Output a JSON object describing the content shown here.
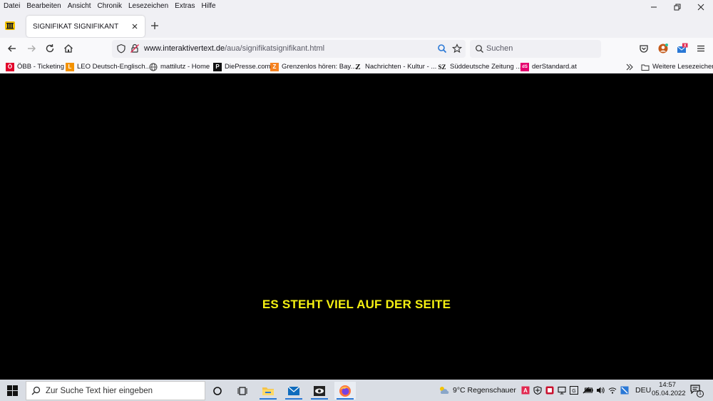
{
  "menu": [
    "Datei",
    "Bearbeiten",
    "Ansicht",
    "Chronik",
    "Lesezeichen",
    "Extras",
    "Hilfe"
  ],
  "tab": {
    "title": "SIGNIFIKAT SIGNIFIKANT"
  },
  "url": {
    "host": "www.interaktivertext.de",
    "path": "/aua/signifikatsignifikant.html"
  },
  "search": {
    "placeholder": "Suchen"
  },
  "bookmarks": [
    {
      "label": "ÖBB - Ticketing",
      "icon": "oebb-icon",
      "color": "#e2002a"
    },
    {
      "label": "LEO Deutsch-Englisch...",
      "icon": "leo-icon",
      "color": "#f39200"
    },
    {
      "label": "mattilutz - Home",
      "icon": "globe-icon",
      "color": "#444"
    },
    {
      "label": "DiePresse.com",
      "icon": "presse-icon",
      "color": "#111"
    },
    {
      "label": "Grenzenlos hören: Bay...",
      "icon": "grenzenlos-icon",
      "color": "#f58220"
    },
    {
      "label": "Nachrichten - Kultur - ...",
      "icon": "zeit-icon",
      "color": "#111"
    },
    {
      "label": "Süddeutsche Zeitung ...",
      "icon": "sz-icon",
      "color": "#111"
    },
    {
      "label": "derStandard.at",
      "icon": "standard-icon",
      "color": "#e5006e"
    }
  ],
  "bookmarks_more": "Weitere Lesezeichen",
  "page": {
    "headline": "ES STEHT VIEL AUF DER SEITE"
  },
  "taskbar": {
    "search_placeholder": "Zur Suche Text hier eingeben",
    "weather": "9°C  Regenschauer",
    "language": "DEU",
    "time": "14:57",
    "date": "05.04.2022",
    "notification_count": "1"
  }
}
